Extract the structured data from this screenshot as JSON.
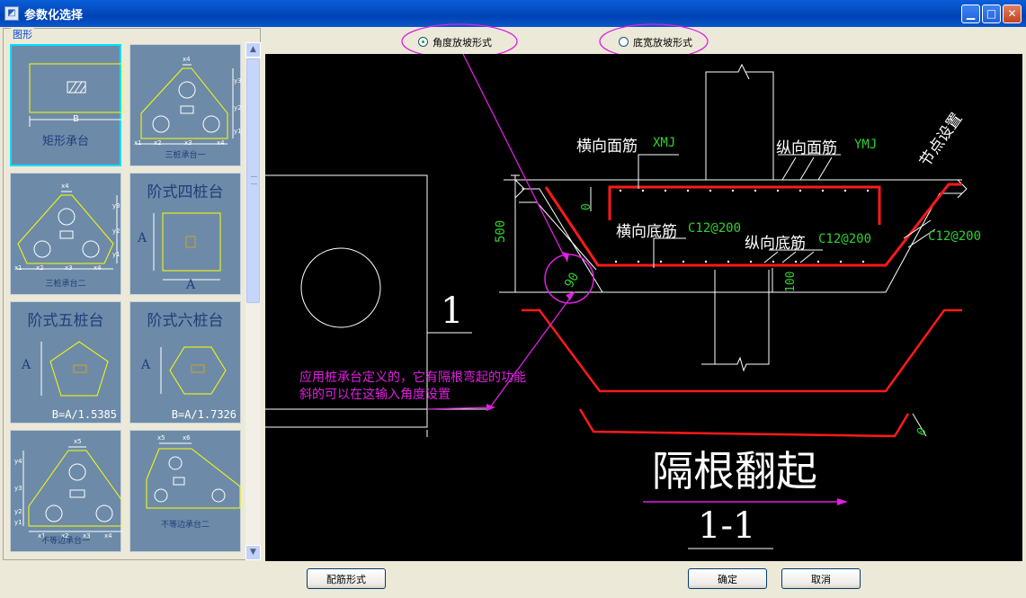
{
  "window": {
    "title": "参数化选择",
    "app_icon": "app-icon",
    "controls": [
      "minimize-icon",
      "maximize-icon",
      "close-icon"
    ]
  },
  "left_panel": {
    "group_label": "图形",
    "thumbnails": [
      {
        "label": "矩形承台",
        "dim": "B",
        "selected": true
      },
      {
        "label": "三桩承台一",
        "dims": [
          "x4",
          "y3",
          "y2",
          "y1",
          "x1",
          "x2",
          "x3",
          "x4"
        ]
      },
      {
        "label": "三桩承台二",
        "dims": [
          "x4",
          "y3",
          "y2",
          "y1",
          "x1",
          "x2",
          "x3",
          "x4"
        ]
      },
      {
        "label": "阶式四桩台",
        "dims": [
          "A",
          "A"
        ]
      },
      {
        "label": "阶式五桩台",
        "dims": [
          "A"
        ],
        "formula": "B=A/1.5385"
      },
      {
        "label": "阶式六桩台",
        "dims": [
          "A"
        ],
        "formula": "B=A/1.7326"
      },
      {
        "label": "不等边承台一",
        "dims": [
          "x5",
          "y4",
          "y3",
          "y2",
          "y1",
          "x1",
          "x2",
          "x3",
          "x4"
        ]
      },
      {
        "label": "不等边承台二",
        "dims": [
          "x5",
          "x6"
        ]
      }
    ]
  },
  "radio_options": [
    {
      "label": "角度放坡形式",
      "checked": true
    },
    {
      "label": "底宽放坡形式",
      "checked": false
    }
  ],
  "drawing": {
    "labels": {
      "top_bar": "横向面筋",
      "top_bar_code": "XMJ",
      "long_top_bar": "纵向面筋",
      "long_top_bar_code": "YMJ",
      "node_setting": "节点设置",
      "bottom_bar": "横向底筋",
      "bottom_bar_code": "C12@200",
      "long_bottom_bar": "纵向底筋",
      "long_bottom_bar_code": "C12@200",
      "side_bar_code": "C12@200",
      "dim_500": "500",
      "dim_100": "100",
      "dim_0a": "0",
      "dim_0b": "0",
      "angle_90": "90",
      "section_mark": "1",
      "big_title": "隔根翻起",
      "section_title": "1-1",
      "note_line1": "应用桩承台定义的，它有隔根弯起的功能",
      "note_line2": "斜的可以在这输入角度设置"
    },
    "colors": {
      "annotation": "#e020e0",
      "rebar": "#ff1a1a",
      "dim_text": "#2fd12f",
      "line": "#ffffff",
      "yellow": "#ffff00"
    }
  },
  "buttons": {
    "rebar_form": "配筋形式",
    "ok": "确定",
    "cancel": "取消"
  }
}
